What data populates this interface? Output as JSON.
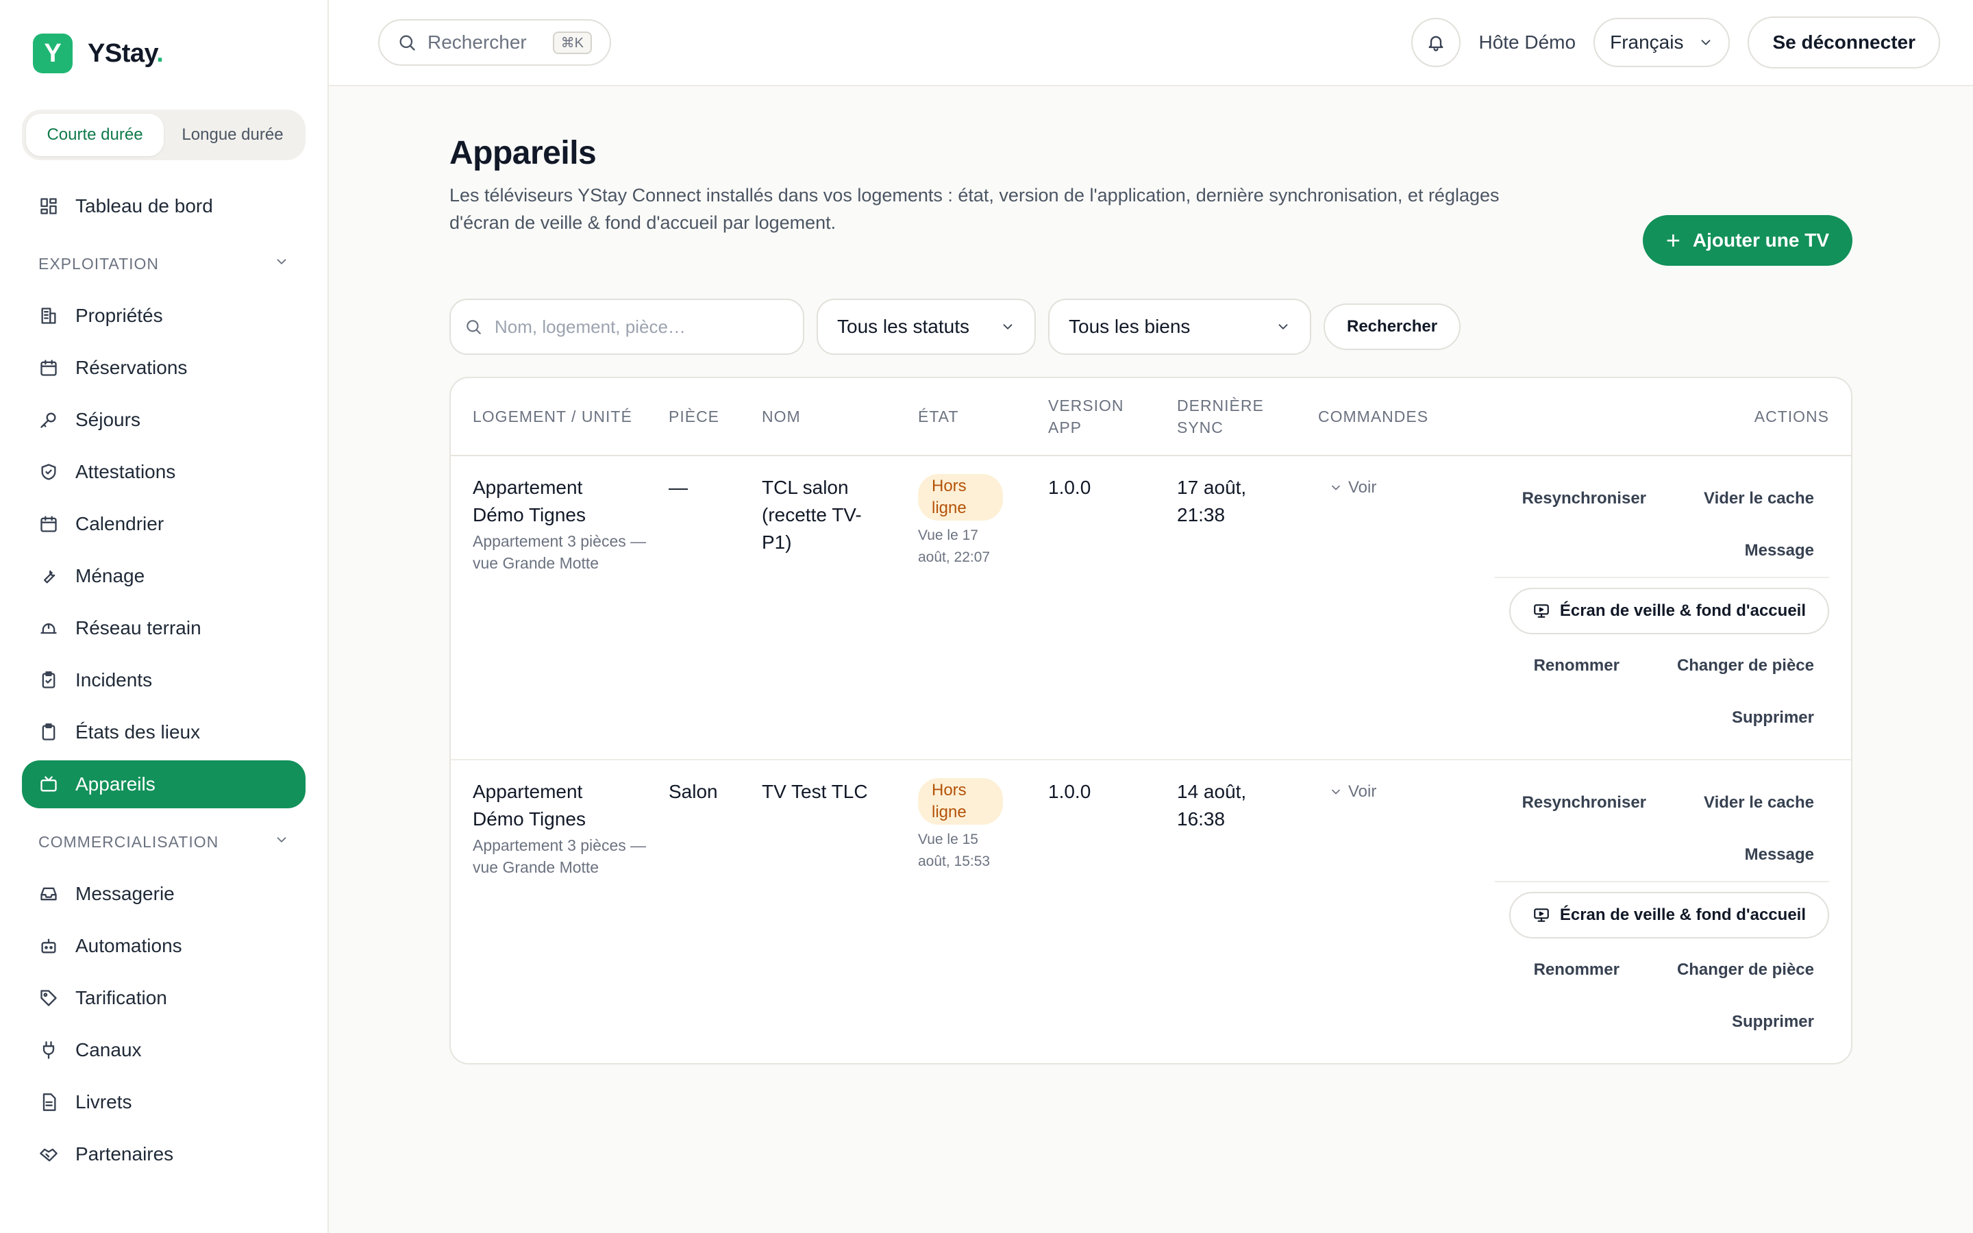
{
  "app": {
    "name": "YStay",
    "name_dot": "."
  },
  "sidebar": {
    "segment": {
      "short": "Courte durée",
      "long": "Longue durée"
    },
    "dashboard": "Tableau de bord",
    "section_ops": "EXPLOITATION",
    "ops_items": [
      {
        "label": "Propriétés",
        "icon": "building-icon"
      },
      {
        "label": "Réservations",
        "icon": "calendar-icon"
      },
      {
        "label": "Séjours",
        "icon": "key-icon"
      },
      {
        "label": "Attestations",
        "icon": "shield-icon"
      },
      {
        "label": "Calendrier",
        "icon": "calendar-icon"
      },
      {
        "label": "Ménage",
        "icon": "wrench-icon"
      },
      {
        "label": "Réseau terrain",
        "icon": "hard-hat-icon"
      },
      {
        "label": "Incidents",
        "icon": "clipboard-check-icon"
      },
      {
        "label": "États des lieux",
        "icon": "clipboard-icon"
      },
      {
        "label": "Appareils",
        "icon": "tv-icon"
      }
    ],
    "section_com": "COMMERCIALISATION",
    "com_items": [
      {
        "label": "Messagerie",
        "icon": "inbox-icon"
      },
      {
        "label": "Automations",
        "icon": "bot-icon"
      },
      {
        "label": "Tarification",
        "icon": "tag-icon"
      },
      {
        "label": "Canaux",
        "icon": "plug-icon"
      },
      {
        "label": "Livrets",
        "icon": "file-icon"
      },
      {
        "label": "Partenaires",
        "icon": "handshake-icon"
      }
    ]
  },
  "topbar": {
    "search_placeholder": "Rechercher",
    "shortcut": "⌘K",
    "host": "Hôte Démo",
    "language": "Français",
    "logout": "Se déconnecter"
  },
  "page": {
    "title": "Appareils",
    "subtitle": "Les téléviseurs YStay Connect installés dans vos logements : état, version de l'application, dernière synchronisation, et réglages d'écran de veille & fond d'accueil par logement.",
    "add_button": "Ajouter une TV",
    "filters": {
      "search_placeholder": "Nom, logement, pièce…",
      "status": "Tous les statuts",
      "property": "Tous les biens",
      "submit": "Rechercher"
    }
  },
  "table": {
    "headers": {
      "unit": "LOGEMENT / UNITÉ",
      "room": "PIÈCE",
      "name": "NOM",
      "state": "ÉTAT",
      "version_1": "VERSION",
      "version_2": "APP",
      "sync_1": "DERNIÈRE",
      "sync_2": "SYNC",
      "commands": "COMMANDES",
      "actions": "ACTIONS"
    },
    "rows": [
      {
        "unit": "Appartement Démo Tignes",
        "unit_sub": "Appartement 3 pièces — vue Grande Motte",
        "room": "—",
        "name": "TCL salon (recette TV-P1)",
        "state": "Hors ligne",
        "seen": "Vue le 17 août, 22:07",
        "version": "1.0.0",
        "sync": "17 août, 21:38",
        "commands": "Voir"
      },
      {
        "unit": "Appartement Démo Tignes",
        "unit_sub": "Appartement 3 pièces — vue Grande Motte",
        "room": "Salon",
        "name": "TV Test TLC",
        "state": "Hors ligne",
        "seen": "Vue le 15 août, 15:53",
        "version": "1.0.0",
        "sync": "14 août, 16:38",
        "commands": "Voir"
      }
    ],
    "actions": {
      "resync": "Resynchroniser",
      "clear_cache": "Vider le cache",
      "message": "Message",
      "screen": "Écran de veille & fond d'accueil",
      "rename": "Renommer",
      "change_room": "Changer de pièce",
      "delete": "Supprimer"
    }
  },
  "colors": {
    "accent": "#12915a",
    "badge_bg": "#fdf0d6",
    "badge_text": "#b45309"
  }
}
